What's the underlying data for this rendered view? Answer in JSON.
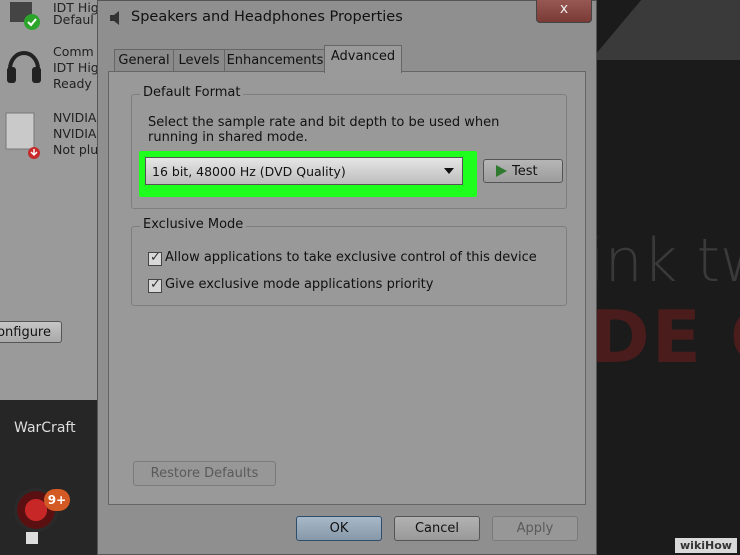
{
  "background": {
    "right_text_1": "ink tw",
    "right_text_2": "DE C",
    "taskbar_label": "WarCraft",
    "app_badge": "9+"
  },
  "devices": [
    {
      "line1": "IDT Hig",
      "line2": "Defaul"
    },
    {
      "line1": "Comm",
      "line2": "IDT Hig",
      "line3": "Ready"
    },
    {
      "line1": "NVIDIA",
      "line2": "NVIDIA",
      "line3": "Not plu"
    }
  ],
  "left_window": {
    "configure_label": "onfigure"
  },
  "dialog": {
    "title": "Speakers and Headphones Properties",
    "close_label": "x",
    "tabs": [
      "General",
      "Levels",
      "Enhancements",
      "Advanced"
    ],
    "active_tab": "Advanced",
    "default_format": {
      "title": "Default Format",
      "description": "Select the sample rate and bit depth to be used when running in shared mode.",
      "selected_format": "16 bit, 48000 Hz (DVD Quality)",
      "test_label": "Test"
    },
    "exclusive_mode": {
      "title": "Exclusive Mode",
      "options": [
        {
          "label": "Allow applications to take exclusive control of this device",
          "checked": true
        },
        {
          "label": "Give exclusive mode applications priority",
          "checked": true
        }
      ]
    },
    "restore_defaults_label": "Restore Defaults",
    "ok_label": "OK",
    "cancel_label": "Cancel",
    "apply_label": "Apply"
  },
  "watermark": "wikiHow",
  "colors": {
    "highlight": "#1eff1e"
  }
}
